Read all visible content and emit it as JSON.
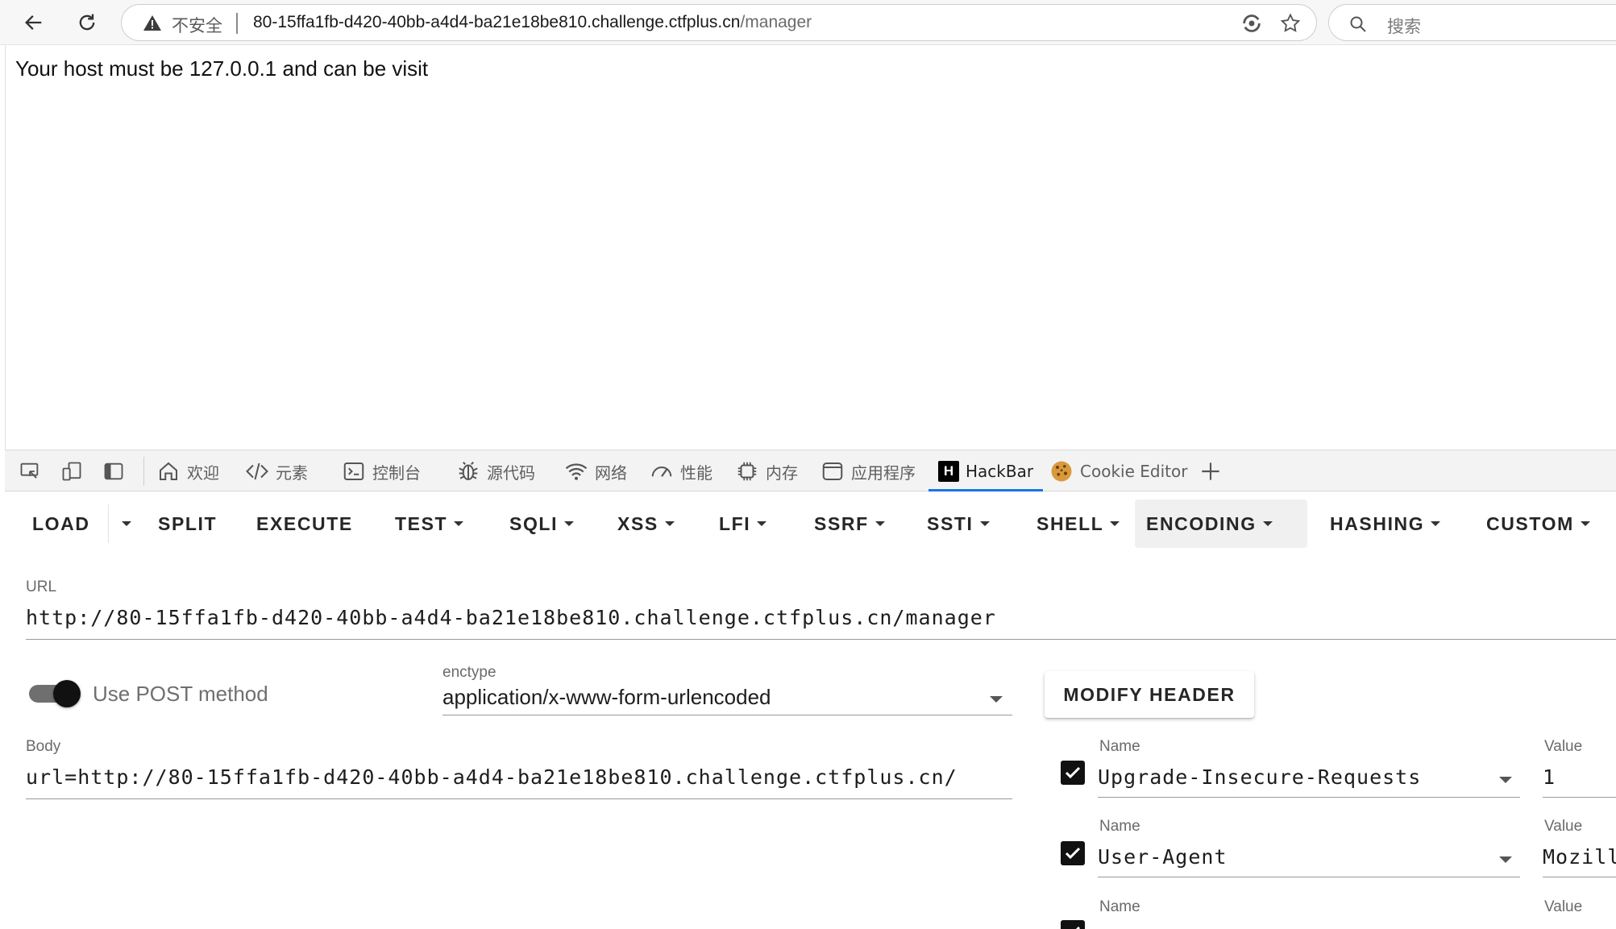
{
  "browser": {
    "security_label": "不安全",
    "url_host": "80-15ffa1fb-d420-40bb-a4d4-ba21e18be810.challenge.ctfplus.cn",
    "url_path": "/manager",
    "search_placeholder": "搜索"
  },
  "page": {
    "message": "Your host must be 127.0.0.1 and can be visit"
  },
  "devtools": {
    "tabs": [
      {
        "label": "欢迎",
        "icon": "home-icon"
      },
      {
        "label": "元素",
        "icon": "code-icon"
      },
      {
        "label": "控制台",
        "icon": "console-icon"
      },
      {
        "label": "源代码",
        "icon": "bug-icon"
      },
      {
        "label": "网络",
        "icon": "wifi-icon"
      },
      {
        "label": "性能",
        "icon": "gauge-icon"
      },
      {
        "label": "内存",
        "icon": "chip-icon"
      },
      {
        "label": "应用程序",
        "icon": "app-window-icon"
      },
      {
        "label": "HackBar",
        "icon": "hackbar-logo-icon",
        "active": true
      },
      {
        "label": "Cookie Editor",
        "icon": "cookie-icon"
      }
    ],
    "accent_color": "#1a73e8"
  },
  "hackbar": {
    "toolbar": {
      "load": "LOAD",
      "split": "SPLIT",
      "execute": "EXECUTE",
      "test": "TEST",
      "sqli": "SQLI",
      "xss": "XSS",
      "lfi": "LFI",
      "ssrf": "SSRF",
      "ssti": "SSTI",
      "shell": "SHELL",
      "encoding": "ENCODING",
      "hashing": "HASHING",
      "custom": "CUSTOM"
    },
    "url_label": "URL",
    "url_value": "http://80-15ffa1fb-d420-40bb-a4d4-ba21e18be810.challenge.ctfplus.cn/manager",
    "post_toggle_label": "Use POST method",
    "post_enabled": true,
    "enctype_label": "enctype",
    "enctype_value": "application/x-www-form-urlencoded",
    "body_label": "Body",
    "body_value": "url=http://80-15ffa1fb-d420-40bb-a4d4-ba21e18be810.challenge.ctfplus.cn/",
    "modify_header_label": "MODIFY HEADER",
    "headers": [
      {
        "name_label": "Name",
        "name": "Upgrade-Insecure-Requests",
        "value_label": "Value",
        "value": "1",
        "checked": true
      },
      {
        "name_label": "Name",
        "name": "User-Agent",
        "value_label": "Value",
        "value": "Mozill",
        "checked": true
      },
      {
        "name_label": "Name",
        "name": "",
        "value_label": "Value",
        "value": "",
        "checked": true
      }
    ]
  }
}
